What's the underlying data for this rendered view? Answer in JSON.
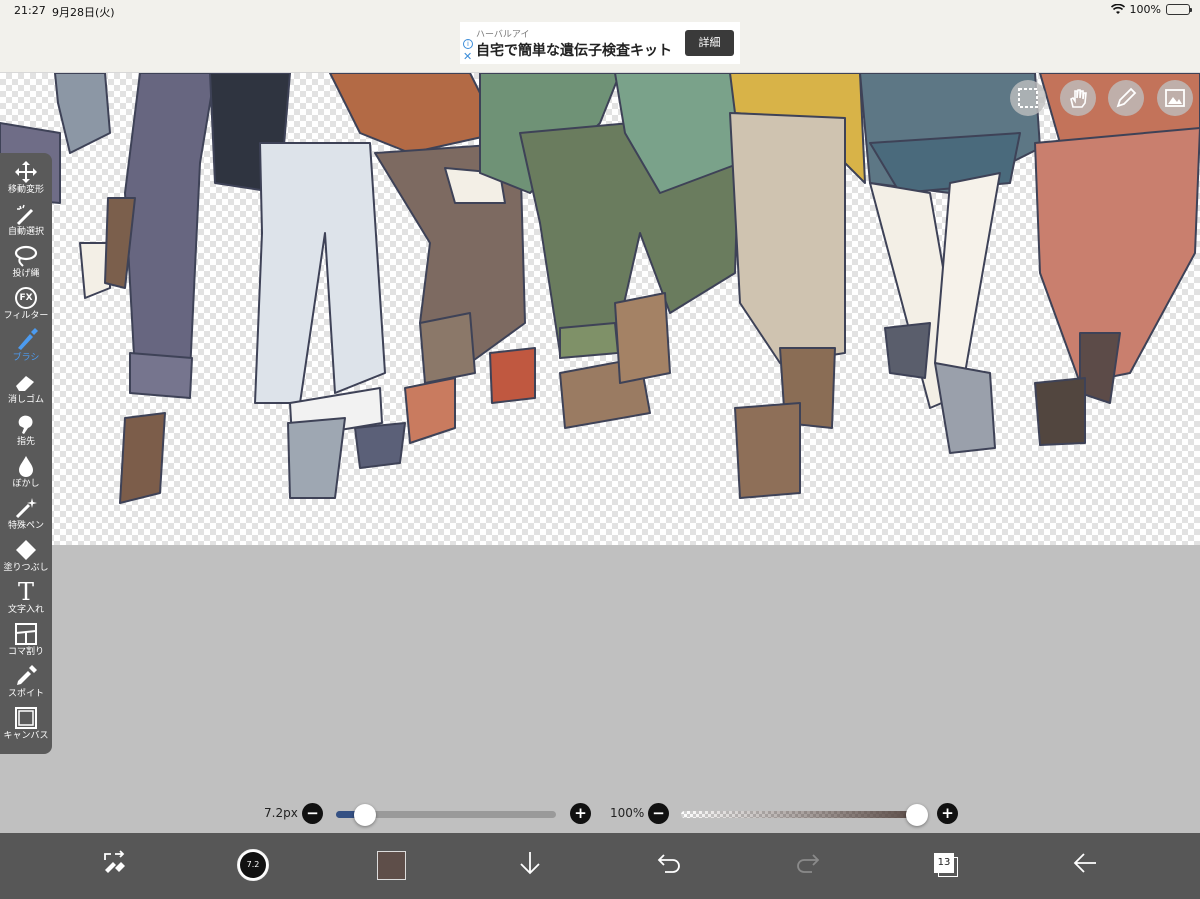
{
  "status_bar": {
    "time": "21:27",
    "date": "9月28日(火)",
    "battery": "100%"
  },
  "ad": {
    "brand": "ハーバルアイ",
    "headline": "自宅で簡単な遺伝子検査キット",
    "cta": "詳細",
    "info_glyph": "i",
    "close_glyph": "✕"
  },
  "toolbar": {
    "items": [
      {
        "label": "移動変形",
        "icon": "move-arrows-icon"
      },
      {
        "label": "自動選択",
        "icon": "magic-wand-icon"
      },
      {
        "label": "投げ縄",
        "icon": "lasso-icon"
      },
      {
        "label": "フィルター",
        "icon": "fx-icon",
        "glyph": "FX"
      },
      {
        "label": "ブラシ",
        "icon": "brush-icon",
        "active": true
      },
      {
        "label": "消しゴム",
        "icon": "eraser-icon"
      },
      {
        "label": "指先",
        "icon": "smudge-finger-icon"
      },
      {
        "label": "ぼかし",
        "icon": "blur-drop-icon"
      },
      {
        "label": "特殊ペン",
        "icon": "special-pen-icon"
      },
      {
        "label": "塗りつぶし",
        "icon": "fill-bucket-icon"
      },
      {
        "label": "文字入れ",
        "icon": "text-icon",
        "glyph": "T"
      },
      {
        "label": "コマ割り",
        "icon": "panel-divide-icon"
      },
      {
        "label": "スポイト",
        "icon": "eyedropper-icon"
      },
      {
        "label": "キャンバス",
        "icon": "canvas-icon"
      }
    ]
  },
  "top_tools": [
    "selection-icon",
    "hand-icon",
    "ruler-pen-icon",
    "material-icon"
  ],
  "brush_size": {
    "label": "7.2px",
    "fraction": 0.13
  },
  "opacity": {
    "label": "100%",
    "fraction": 1.0
  },
  "bottom_bar": {
    "brush_size_preview": "7.2",
    "layer_count": "13",
    "color": "#5e4e49"
  }
}
